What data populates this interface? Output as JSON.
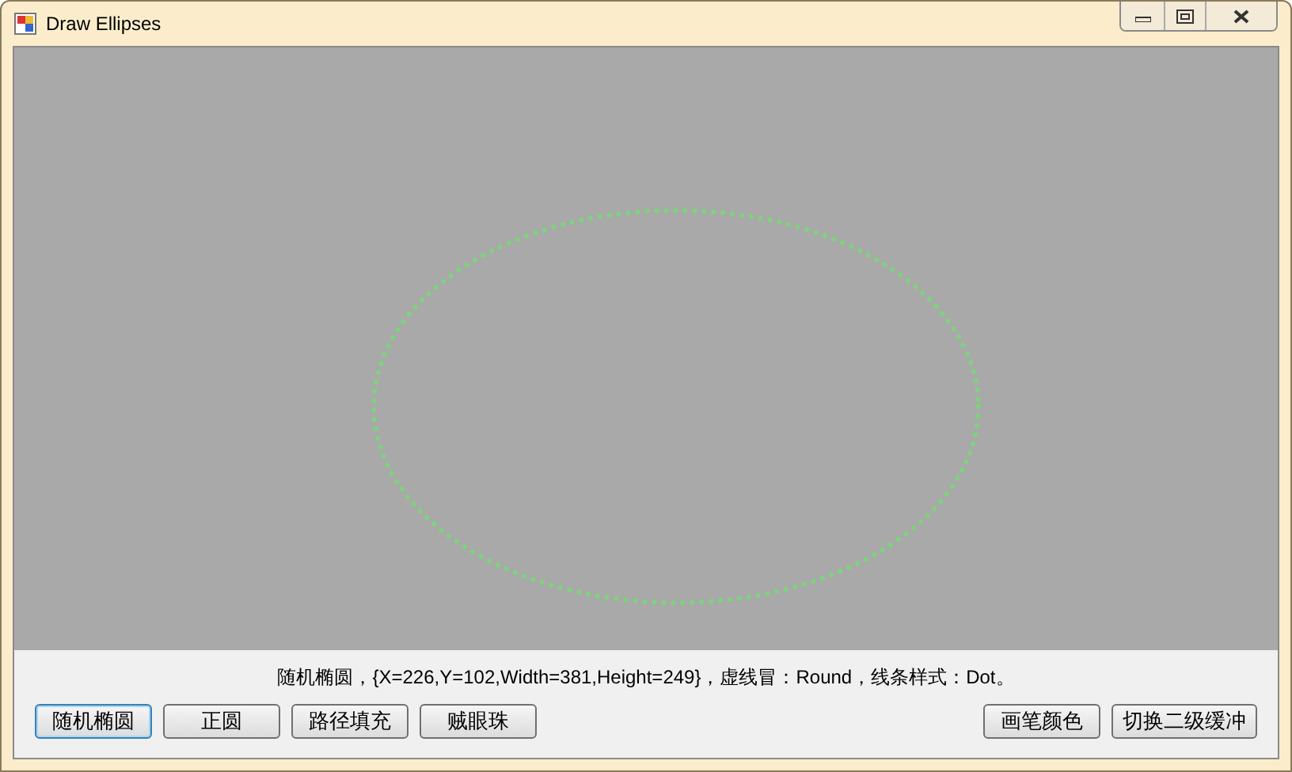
{
  "window": {
    "title": "Draw Ellipses"
  },
  "status_text": "随机椭圆，{X=226,Y=102,Width=381,Height=249}，虚线冒：Round，线条样式：Dot。",
  "left_buttons": [
    {
      "label": "随机椭圆",
      "focused": true
    },
    {
      "label": "正圆",
      "focused": false
    },
    {
      "label": "路径填充",
      "focused": false
    },
    {
      "label": "贼眼珠",
      "focused": false
    }
  ],
  "right_buttons": [
    {
      "label": "画笔颜色",
      "focused": false
    },
    {
      "label": "切换二级缓冲",
      "focused": false
    }
  ]
}
